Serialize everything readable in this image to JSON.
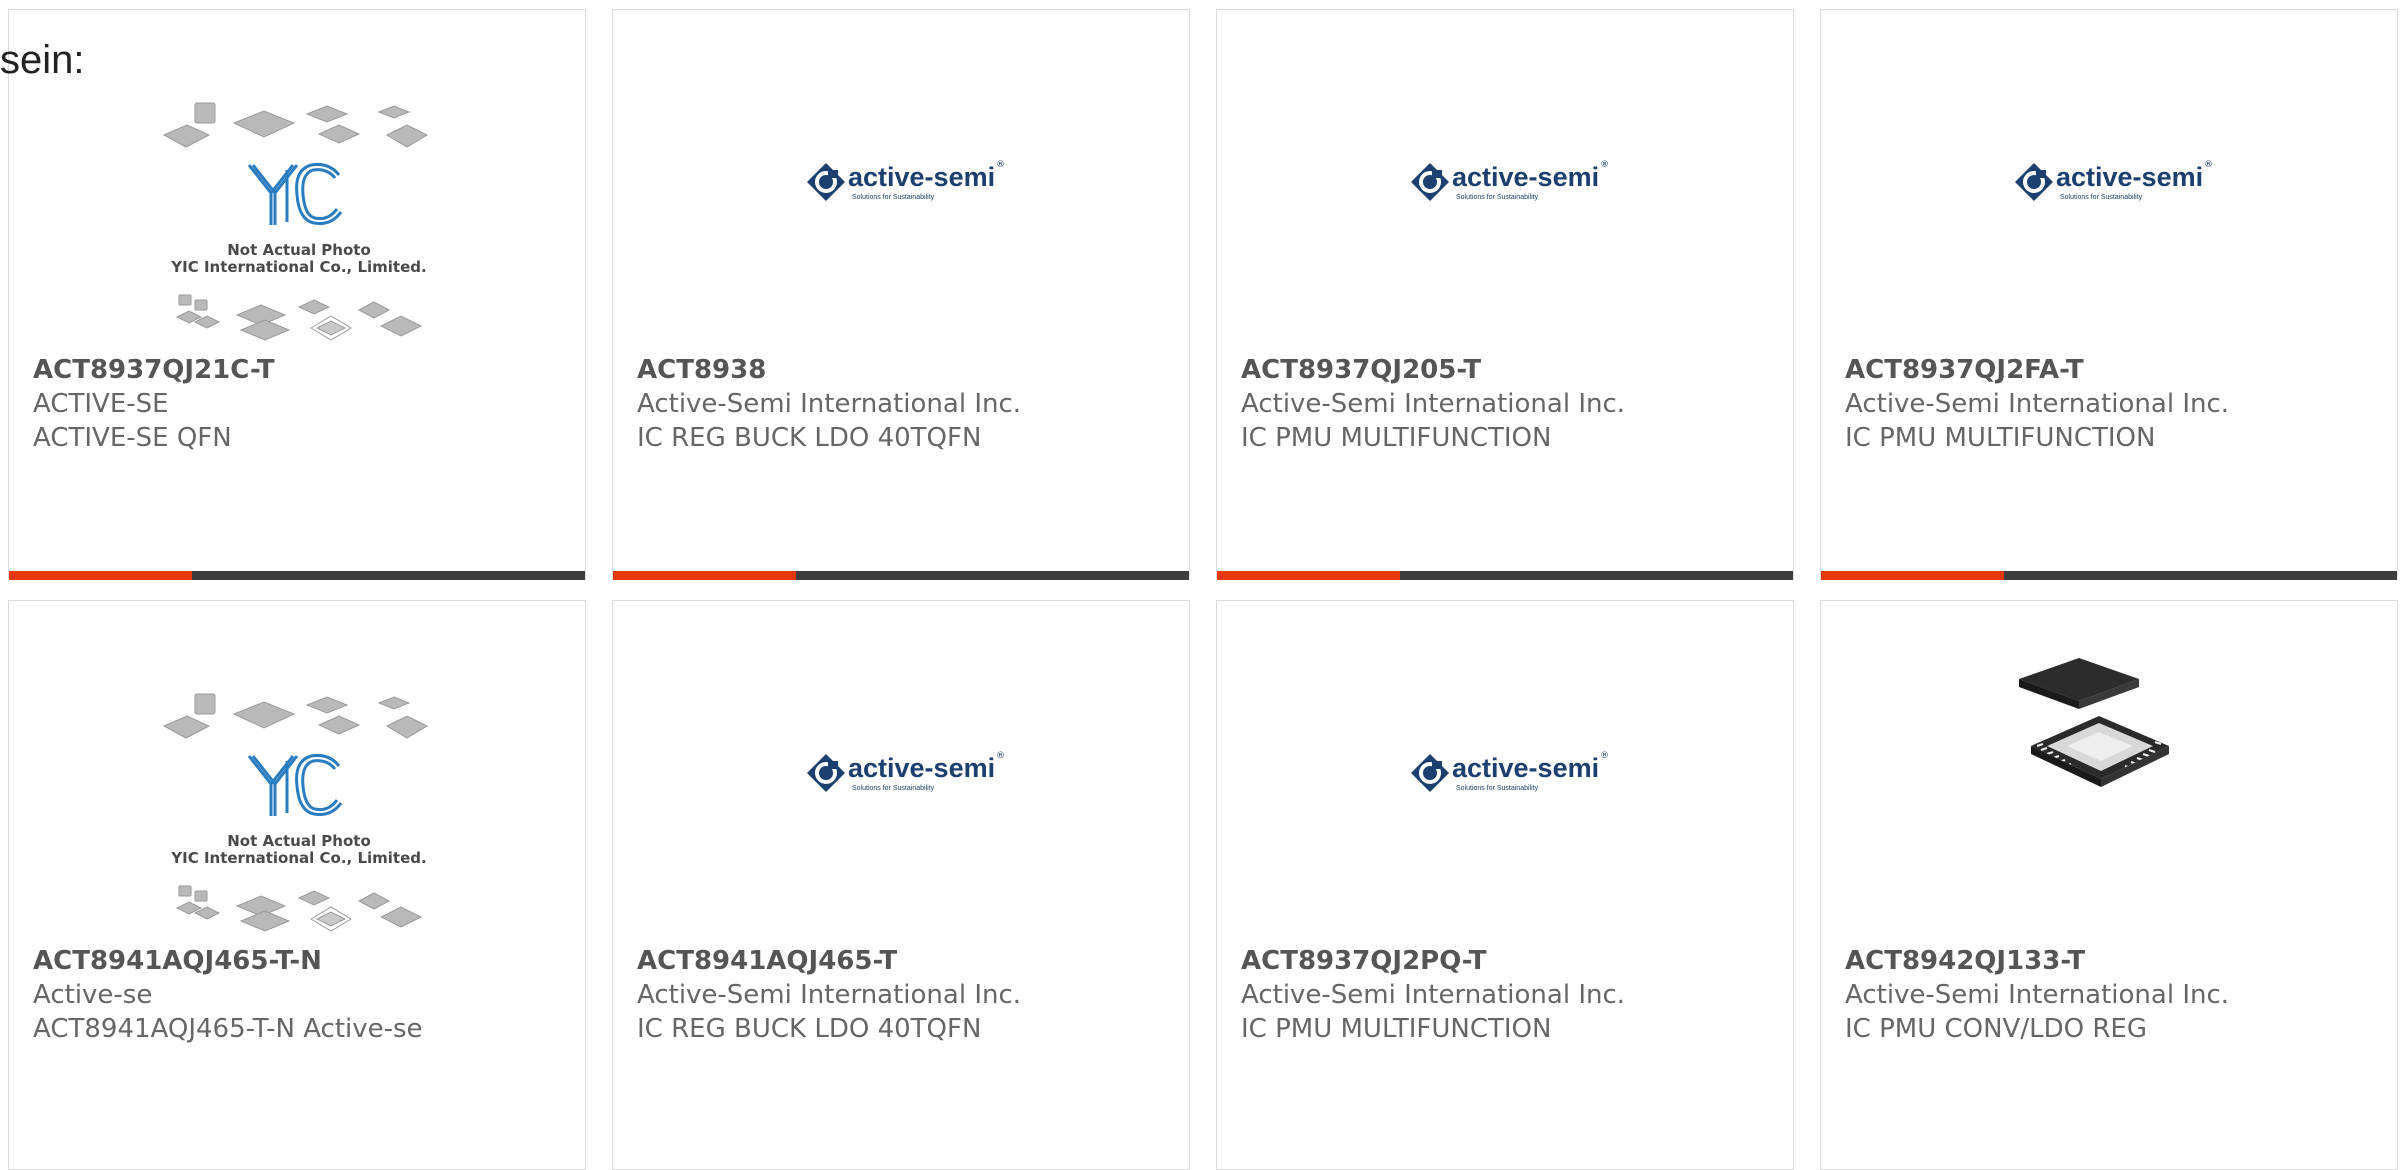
{
  "overlay_text": "sein:",
  "products": [
    {
      "part_number": "ACT8937QJ21C-T",
      "manufacturer": "ACTIVE-SE",
      "description": "ACTIVE-SE QFN",
      "image": "yic-placeholder",
      "has_bar": true
    },
    {
      "part_number": "ACT8938",
      "manufacturer": "Active-Semi International Inc.",
      "description": "IC REG BUCK LDO 40TQFN",
      "image": "active-semi-logo",
      "has_bar": true
    },
    {
      "part_number": "ACT8937QJ205-T",
      "manufacturer": "Active-Semi International Inc.",
      "description": "IC PMU MULTIFUNCTION",
      "image": "active-semi-logo",
      "has_bar": true
    },
    {
      "part_number": "ACT8937QJ2FA-T",
      "manufacturer": "Active-Semi International Inc.",
      "description": "IC PMU MULTIFUNCTION",
      "image": "active-semi-logo",
      "has_bar": true
    },
    {
      "part_number": "ACT8941AQJ465-T-N",
      "manufacturer": "Active-se",
      "description": "ACT8941AQJ465-T-N Active-se",
      "image": "yic-placeholder",
      "has_bar": false
    },
    {
      "part_number": "ACT8941AQJ465-T",
      "manufacturer": "Active-Semi International Inc.",
      "description": "IC REG BUCK LDO 40TQFN",
      "image": "active-semi-logo",
      "has_bar": false
    },
    {
      "part_number": "ACT8937QJ2PQ-T",
      "manufacturer": "Active-Semi International Inc.",
      "description": "IC PMU MULTIFUNCTION",
      "image": "active-semi-logo",
      "has_bar": false
    },
    {
      "part_number": "ACT8942QJ133-T",
      "manufacturer": "Active-Semi International Inc.",
      "description": "IC PMU CONV/LDO REG",
      "image": "qfn-chip-photo",
      "has_bar": false
    }
  ],
  "logo": {
    "wordmark": "active-semi",
    "tagline": "Solutions for Sustainability",
    "registered": "®"
  },
  "placeholder": {
    "brand": "YIC",
    "line1": "Not Actual Photo",
    "line2": "YIC International Co., Limited."
  },
  "colors": {
    "accent": "#e8380d",
    "bar": "#3c3c3c",
    "logo_blue": "#1b3f6e",
    "yic_blue": "#2a7cc0"
  }
}
